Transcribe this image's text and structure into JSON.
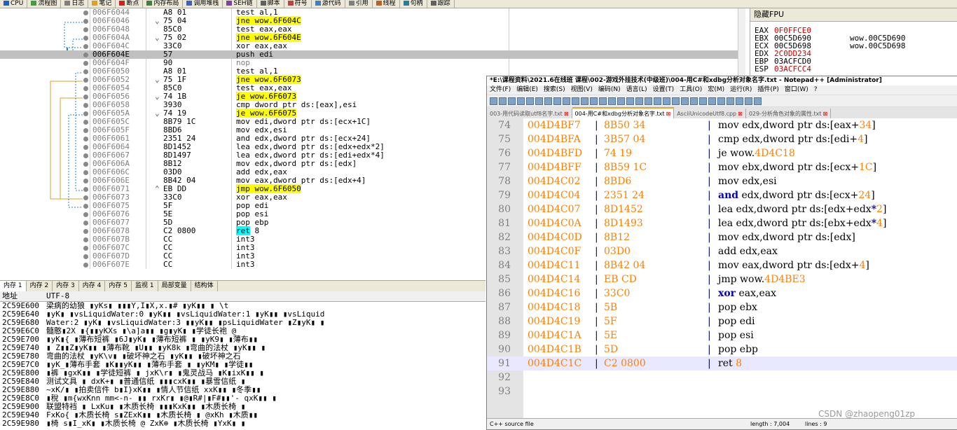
{
  "toolbar": [
    {
      "label": "CPU",
      "icon": "cpu-icon",
      "color": "#2060c0"
    },
    {
      "label": "流程图",
      "icon": "flowchart-icon",
      "color": "#40a040"
    },
    {
      "label": "日志",
      "icon": "log-icon",
      "color": "#808080"
    },
    {
      "label": "笔记",
      "icon": "notes-icon",
      "color": "#e0a020"
    },
    {
      "label": "断点",
      "icon": "breakpoint-icon",
      "color": "#d02020"
    },
    {
      "label": "内存布局",
      "icon": "memory-map-icon",
      "color": "#408040"
    },
    {
      "label": "调用堆栈",
      "icon": "call-stack-icon",
      "color": "#4060c0"
    },
    {
      "label": "SEH链",
      "icon": "seh-icon",
      "color": "#8040a0"
    },
    {
      "label": "脚本",
      "icon": "script-icon",
      "color": "#606060"
    },
    {
      "label": "符号",
      "icon": "symbols-icon",
      "color": "#c04040"
    },
    {
      "label": "源代码",
      "icon": "source-icon",
      "color": "#4080c0"
    },
    {
      "label": "引用",
      "icon": "references-icon",
      "color": "#808080"
    },
    {
      "label": "线程",
      "icon": "threads-icon",
      "color": "#c06020"
    },
    {
      "label": "句柄",
      "icon": "handles-icon",
      "color": "#2080a0"
    },
    {
      "label": "跟踪",
      "icon": "trace-icon",
      "color": "#606060"
    }
  ],
  "disasm": [
    {
      "addr": "006F6044",
      "mark": "",
      "bytes": "A8 01",
      "instr": [
        {
          "t": "test al,1"
        }
      ]
    },
    {
      "addr": "006F6046",
      "mark": "⌄",
      "bytes": "75 04",
      "instr": [
        {
          "t": "jne wow.6F604C",
          "c": "hl"
        }
      ]
    },
    {
      "addr": "006F6048",
      "mark": "",
      "bytes": "85C0",
      "instr": [
        {
          "t": "test eax,eax"
        }
      ]
    },
    {
      "addr": "006F604A",
      "mark": "⌄",
      "bytes": "75 02",
      "instr": [
        {
          "t": "jne wow.6F604E",
          "c": "hl"
        }
      ]
    },
    {
      "addr": "006F604C",
      "mark": "",
      "bytes": "33C0",
      "instr": [
        {
          "t": "xor eax,eax"
        }
      ]
    },
    {
      "addr": "006F604E",
      "mark": "",
      "bytes": "57",
      "instr": [
        {
          "t": "push edi"
        }
      ],
      "sel": true
    },
    {
      "addr": "006F604F",
      "mark": "",
      "bytes": "90",
      "instr": [
        {
          "t": "nop",
          "c": "dim"
        }
      ]
    },
    {
      "addr": "006F6050",
      "mark": "",
      "bytes": "A8 01",
      "instr": [
        {
          "t": "test al,1"
        }
      ]
    },
    {
      "addr": "006F6052",
      "mark": "⌄",
      "bytes": "75 1F",
      "instr": [
        {
          "t": "jne wow.6F6073",
          "c": "hl"
        }
      ]
    },
    {
      "addr": "006F6054",
      "mark": "",
      "bytes": "85C0",
      "instr": [
        {
          "t": "test eax,eax"
        }
      ]
    },
    {
      "addr": "006F6056",
      "mark": "⌄",
      "bytes": "74 1B",
      "instr": [
        {
          "t": "je wow.6F6073",
          "c": "hl"
        }
      ]
    },
    {
      "addr": "006F6058",
      "mark": "",
      "bytes": "3930",
      "instr": [
        {
          "t": "cmp dword ptr ds:[eax],esi"
        }
      ]
    },
    {
      "addr": "006F605A",
      "mark": "⌄",
      "bytes": "74 19",
      "instr": [
        {
          "t": "je wow.6F6075",
          "c": "hl"
        }
      ]
    },
    {
      "addr": "006F605C",
      "mark": "",
      "bytes": "8B79 1C",
      "instr": [
        {
          "t": "mov edi,dword ptr ds:[ecx+1C]"
        }
      ]
    },
    {
      "addr": "006F605F",
      "mark": "",
      "bytes": "8BD6",
      "instr": [
        {
          "t": "mov edx,esi"
        }
      ]
    },
    {
      "addr": "006F6061",
      "mark": "",
      "bytes": "2351 24",
      "instr": [
        {
          "t": "and edx,dword ptr ds:[ecx+24]"
        }
      ]
    },
    {
      "addr": "006F6064",
      "mark": "",
      "bytes": "8D1452",
      "instr": [
        {
          "t": "lea edx,dword ptr ds:[edx+edx*2]"
        }
      ]
    },
    {
      "addr": "006F6067",
      "mark": "",
      "bytes": "8D1497",
      "instr": [
        {
          "t": "lea edx,dword ptr ds:[edi+edx*4]"
        }
      ]
    },
    {
      "addr": "006F606A",
      "mark": "",
      "bytes": "8B12",
      "instr": [
        {
          "t": "mov edx,dword ptr ds:[edx]"
        }
      ]
    },
    {
      "addr": "006F606C",
      "mark": "",
      "bytes": "03D0",
      "instr": [
        {
          "t": "add edx,eax"
        }
      ]
    },
    {
      "addr": "006F606E",
      "mark": "",
      "bytes": "8B42 04",
      "instr": [
        {
          "t": "mov eax,dword ptr ds:[edx+4]"
        }
      ]
    },
    {
      "addr": "006F6071",
      "mark": "⌃",
      "bytes": "EB DD",
      "instr": [
        {
          "t": "jmp wow.6F6050",
          "c": "hl"
        }
      ]
    },
    {
      "addr": "006F6073",
      "mark": "",
      "bytes": "33C0",
      "instr": [
        {
          "t": "xor eax,eax"
        }
      ]
    },
    {
      "addr": "006F6075",
      "mark": "",
      "bytes": "5F",
      "instr": [
        {
          "t": "pop edi"
        }
      ]
    },
    {
      "addr": "006F6076",
      "mark": "",
      "bytes": "5E",
      "instr": [
        {
          "t": "pop esi"
        }
      ]
    },
    {
      "addr": "006F6077",
      "mark": "",
      "bytes": "5D",
      "instr": [
        {
          "t": "pop ebp"
        }
      ]
    },
    {
      "addr": "006F6078",
      "mark": "",
      "bytes": "C2 0800",
      "instr": [
        {
          "t": "ret",
          "c": "hlc"
        },
        {
          "t": " 8"
        }
      ]
    },
    {
      "addr": "006F607B",
      "mark": "",
      "bytes": "CC",
      "instr": [
        {
          "t": "int3"
        }
      ]
    },
    {
      "addr": "006F607C",
      "mark": "",
      "bytes": "CC",
      "instr": [
        {
          "t": "int3"
        }
      ]
    },
    {
      "addr": "006F607D",
      "mark": "",
      "bytes": "CC",
      "instr": [
        {
          "t": "int3"
        }
      ]
    },
    {
      "addr": "006F607E",
      "mark": "",
      "bytes": "CC",
      "instr": [
        {
          "t": "int3"
        }
      ]
    }
  ],
  "fpu": {
    "title": "隐藏FPU",
    "regs": [
      {
        "n": "EAX",
        "v": "0F0FFCE0",
        "c": "",
        "r": true
      },
      {
        "n": "EBX",
        "v": "00C5D690",
        "c": "wow.00C5D690",
        "r": false
      },
      {
        "n": "ECX",
        "v": "00C5D698",
        "c": "wow.00C5D698",
        "r": false
      },
      {
        "n": "EDX",
        "v": "2C0DD234",
        "c": "",
        "r": true
      },
      {
        "n": "EBP",
        "v": "03ACFCD0",
        "c": "",
        "r": false
      },
      {
        "n": "ESP",
        "v": "03ACFCC4",
        "c": "",
        "r": true
      }
    ]
  },
  "memtabs": [
    {
      "label": "内存 1",
      "active": true
    },
    {
      "label": "内存 2"
    },
    {
      "label": "内存 3"
    },
    {
      "label": "内存 4"
    },
    {
      "label": "内存 5"
    },
    {
      "label": "监视 1"
    },
    {
      "label": "局部变量"
    },
    {
      "label": "结构体"
    }
  ],
  "memheader": {
    "addr": "地址",
    "enc": "UTF-8"
  },
  "memrows": [
    {
      "a": "2C59E600",
      "t": "梁病的幼狼 ▮yKs▮ ▮▮▮Y,I▮X,x.▮#     ▮yK▮▮ ▮           \\t"
    },
    {
      "a": "2C59E640",
      "t": "▮yK▮ ▮vsLiquidWater:0 ▮yK▮▮ ▮vsLiquidWater:1 ▮yK▮▮ ▮vsLiquid"
    },
    {
      "a": "2C59E680",
      "t": "Water:2 ▮yK▮  ▮vsLiquidWater:3 ▮▮yK▮▮ ▮psLiquidWater ▮Z▮yK▮  ▮"
    },
    {
      "a": "2C59E6C0",
      "t": "髓憨▮2X ▮{▮▮yKXs ▮\\a]a▮▮ ▮g▮yK▮  ▮学徒长袍  @"
    },
    {
      "a": "2C59E700",
      "t": "▮yK▮{ ▮薄布短裤 ▮6J▮yK▮  ▮薄布短裤 ▮  ▮yK9▮ ▮薄布▮▮"
    },
    {
      "a": "2C59E740",
      "t": "▮   Z▮▮Z▮yK▮▮ ▮薄布靴 ▮U▮▮  ▮yK8k ▮弯曲的法杖 ▮yK▮▮ ▮"
    },
    {
      "a": "2C59E780",
      "t": "弯曲的法杖 ▮yK\\v▮ ▮破坏神之石 ▮yK▮▮ ▮破坏神之石"
    },
    {
      "a": "2C59E7C0",
      "t": "▮yK_▮薄布手套 ▮K▮▮yK▮▮ ▮薄布手套 ▮  ▮yKM▮ ▮学徒▮▮"
    },
    {
      "a": "2C59E800",
      "t": "▮裤 ▮gxK▮▮ ▮学徒短裤 ▮  jxK\\r▮ ▮鬼灵战马 ▮K▮ixK▮▮ ▮"
    },
    {
      "a": "2C59E840",
      "t": "测试文具 ▮  dxK+▮ ▮普通信纸 ▮▮▮cxK▮▮ ▮暴雪信纸 ▮"
    },
    {
      "a": "2C59E880",
      "t": "~xK/▮ ▮拍卖信件 b▮I}xK▮▮ ▮情人节信纸 xxK▮▮ ▮冬季▮▮"
    },
    {
      "a": "2C59E8C0",
      "t": "▮稅 ▮m{wxKnn mm<-n-      ▮▮ rxKr▮ ▮@▮R#|▮F#▮▮'-    qxK▮▮ ▮"
    },
    {
      "a": "2C59E900",
      "t": "联盟特裆 ▮  LxKu▮ ▮木质长椅 ▮▮▮KxK▮▮ ▮木质长椅 ▮"
    },
    {
      "a": "2C59E940",
      "t": "FxKo{ ▮木质长椅 s▮ZExK▮▮ ▮木质长椅 ▮  @xKh ▮木质▮▮"
    },
    {
      "a": "2C59E980",
      "t": "▮椅 s▮I_xK▮  ▮木质长椅  @ ZxK⊕ ▮木质长椅 ▮YxK▮  ▮"
    }
  ],
  "npp": {
    "title": "*E:\\课程资料\\2021.6在线班 课程\\002-游戏外挂技术(中级班)\\004-用C#和xdbg分析对象名字.txt - Notepad++ [Administrator]",
    "menu": [
      "文件(F)",
      "编辑(E)",
      "搜索(S)",
      "视图(V)",
      "编码(N)",
      "语言(L)",
      "设置(T)",
      "工具(O)",
      "宏(M)",
      "运行(R)",
      "插件(P)",
      "窗口(W)",
      "?"
    ],
    "tabs": [
      {
        "label": "003-用代码读取utf8名字.txt"
      },
      {
        "label": "004-用C#和xdbg分析对象名字.txt",
        "active": true
      },
      {
        "label": "AsciiUnicodeUtf8.cpp"
      },
      {
        "label": "029-分析角色对象的属性.txt"
      }
    ],
    "lines": [
      {
        "n": "74",
        "a": "004D4BF7",
        "b": "8B50 34",
        "i": [
          {
            "t": "mov edx,dword ptr ds:[eax+"
          },
          {
            "t": "34",
            "c": "num"
          },
          {
            "t": "]"
          }
        ]
      },
      {
        "n": "75",
        "a": "004D4BFA",
        "b": "3B57 04",
        "i": [
          {
            "t": "cmp edx,dword ptr ds:[edi+"
          },
          {
            "t": "4",
            "c": "num"
          },
          {
            "t": "]"
          }
        ]
      },
      {
        "n": "76",
        "a": "004D4BFD",
        "b": "74 19",
        "i": [
          {
            "t": "je wow."
          },
          {
            "t": "4D4C18",
            "c": "num"
          }
        ]
      },
      {
        "n": "77",
        "a": "004D4BFF",
        "b": "8B59 1C",
        "i": [
          {
            "t": "mov ebx,dword ptr ds:[ecx+"
          },
          {
            "t": "1C",
            "c": "num"
          },
          {
            "t": "]"
          }
        ]
      },
      {
        "n": "78",
        "a": "004D4C02",
        "b": "8BD6",
        "i": [
          {
            "t": "mov edx,esi"
          }
        ]
      },
      {
        "n": "79",
        "a": "004D4C04",
        "b": "2351 24",
        "i": [
          {
            "t": "and",
            "c": "bold"
          },
          {
            "t": " edx,dword ptr ds:[ecx+"
          },
          {
            "t": "24",
            "c": "num"
          },
          {
            "t": "]"
          }
        ]
      },
      {
        "n": "80",
        "a": "004D4C07",
        "b": "8D1452",
        "i": [
          {
            "t": "lea edx,dword ptr ds:[edx+edx"
          },
          {
            "t": "*",
            "c": "bold"
          },
          {
            "t": "2",
            "c": "num"
          },
          {
            "t": "]"
          }
        ]
      },
      {
        "n": "81",
        "a": "004D4C0A",
        "b": "8D1493",
        "i": [
          {
            "t": "lea edx,dword ptr ds:[ebx+edx"
          },
          {
            "t": "*",
            "c": "bold"
          },
          {
            "t": "4",
            "c": "num"
          },
          {
            "t": "]"
          }
        ]
      },
      {
        "n": "82",
        "a": "004D4C0D",
        "b": "8B12",
        "i": [
          {
            "t": "mov edx,dword ptr ds:[edx]"
          }
        ]
      },
      {
        "n": "83",
        "a": "004D4C0F",
        "b": "03D0",
        "i": [
          {
            "t": "add edx,eax"
          }
        ]
      },
      {
        "n": "84",
        "a": "004D4C11",
        "b": "8B42 04",
        "i": [
          {
            "t": "mov eax,dword ptr ds:[edx+"
          },
          {
            "t": "4",
            "c": "num"
          },
          {
            "t": "]"
          }
        ]
      },
      {
        "n": "85",
        "a": "004D4C14",
        "b": "EB CD",
        "i": [
          {
            "t": "jmp wow."
          },
          {
            "t": "4D4BE3",
            "c": "num"
          }
        ]
      },
      {
        "n": "86",
        "a": "004D4C16",
        "b": "33C0",
        "i": [
          {
            "t": "xor",
            "c": "bold"
          },
          {
            "t": " eax,eax"
          }
        ]
      },
      {
        "n": "87",
        "a": "004D4C18",
        "b": "5B",
        "i": [
          {
            "t": "pop ebx"
          }
        ]
      },
      {
        "n": "88",
        "a": "004D4C19",
        "b": "5F",
        "i": [
          {
            "t": "pop edi"
          }
        ]
      },
      {
        "n": "89",
        "a": "004D4C1A",
        "b": "5E",
        "i": [
          {
            "t": "pop esi"
          }
        ]
      },
      {
        "n": "90",
        "a": "004D4C1B",
        "b": "5D",
        "i": [
          {
            "t": "pop ebp"
          }
        ]
      },
      {
        "n": "91",
        "a": "004D4C1C",
        "b": "C2 0800",
        "i": [
          {
            "t": "ret "
          },
          {
            "t": "8",
            "c": "num"
          }
        ],
        "cur": true
      },
      {
        "n": "92",
        "a": "",
        "b": "",
        "i": []
      },
      {
        "n": "93",
        "a": "",
        "b": "",
        "i": []
      }
    ],
    "status": {
      "type": "C++ source file",
      "length": "length : 7,004",
      "lines": "lines : 9"
    }
  },
  "watermark": "CSDN @zhaopeng01zp"
}
